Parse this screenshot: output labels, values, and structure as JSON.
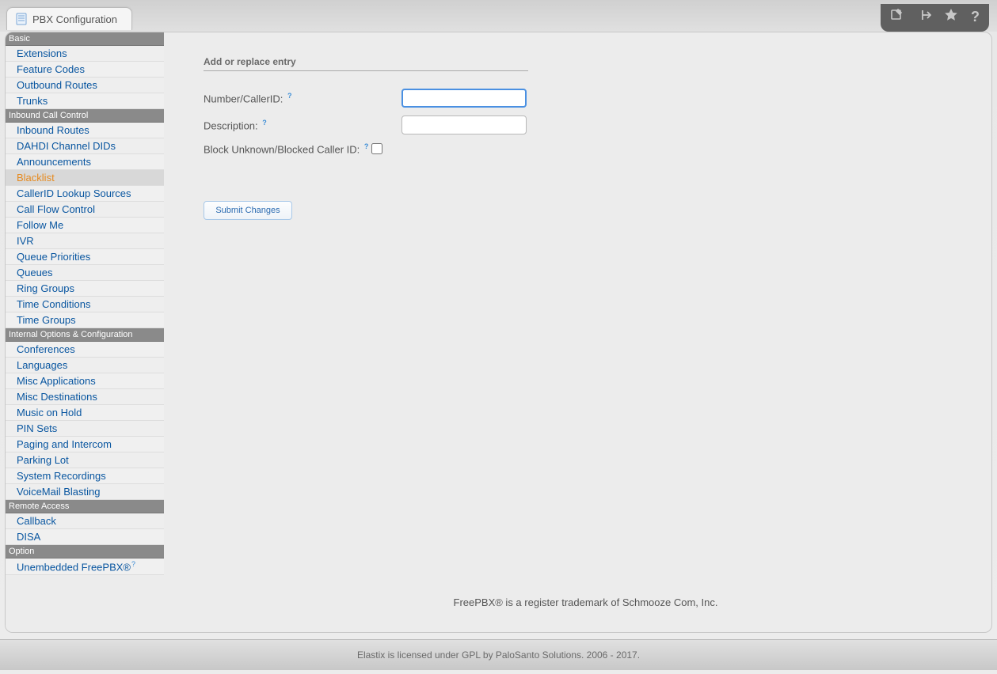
{
  "header": {
    "tab_title": "PBX Configuration"
  },
  "sidebar": {
    "categories": [
      {
        "title": "Basic",
        "items": [
          {
            "label": "Extensions"
          },
          {
            "label": "Feature Codes"
          },
          {
            "label": "Outbound Routes"
          },
          {
            "label": "Trunks"
          }
        ]
      },
      {
        "title": "Inbound Call Control",
        "items": [
          {
            "label": "Inbound Routes"
          },
          {
            "label": "DAHDI Channel DIDs"
          },
          {
            "label": "Announcements"
          },
          {
            "label": "Blacklist",
            "active": true
          },
          {
            "label": "CallerID Lookup Sources"
          },
          {
            "label": "Call Flow Control"
          },
          {
            "label": "Follow Me"
          },
          {
            "label": "IVR"
          },
          {
            "label": "Queue Priorities"
          },
          {
            "label": "Queues"
          },
          {
            "label": "Ring Groups"
          },
          {
            "label": "Time Conditions"
          },
          {
            "label": "Time Groups"
          }
        ]
      },
      {
        "title": "Internal Options & Configuration",
        "items": [
          {
            "label": "Conferences"
          },
          {
            "label": "Languages"
          },
          {
            "label": "Misc Applications"
          },
          {
            "label": "Misc Destinations"
          },
          {
            "label": "Music on Hold"
          },
          {
            "label": "PIN Sets"
          },
          {
            "label": "Paging and Intercom"
          },
          {
            "label": "Parking Lot"
          },
          {
            "label": "System Recordings"
          },
          {
            "label": "VoiceMail Blasting"
          }
        ]
      },
      {
        "title": "Remote Access",
        "items": [
          {
            "label": "Callback"
          },
          {
            "label": "DISA"
          }
        ]
      },
      {
        "title": "Option",
        "items": [
          {
            "label": "Unembedded FreePBX®",
            "help": true
          }
        ]
      }
    ]
  },
  "form": {
    "section_title": "Add or replace entry",
    "fields": {
      "number_label": "Number/CallerID:",
      "number_value": "",
      "description_label": "Description:",
      "description_value": "",
      "block_label": "Block Unknown/Blocked Caller ID:"
    },
    "submit_label": "Submit Changes"
  },
  "footer": {
    "trademark": "FreePBX® is a register trademark of Schmooze Com, Inc.",
    "license": "Elastix is licensed under GPL by PaloSanto Solutions. 2006 - 2017."
  }
}
